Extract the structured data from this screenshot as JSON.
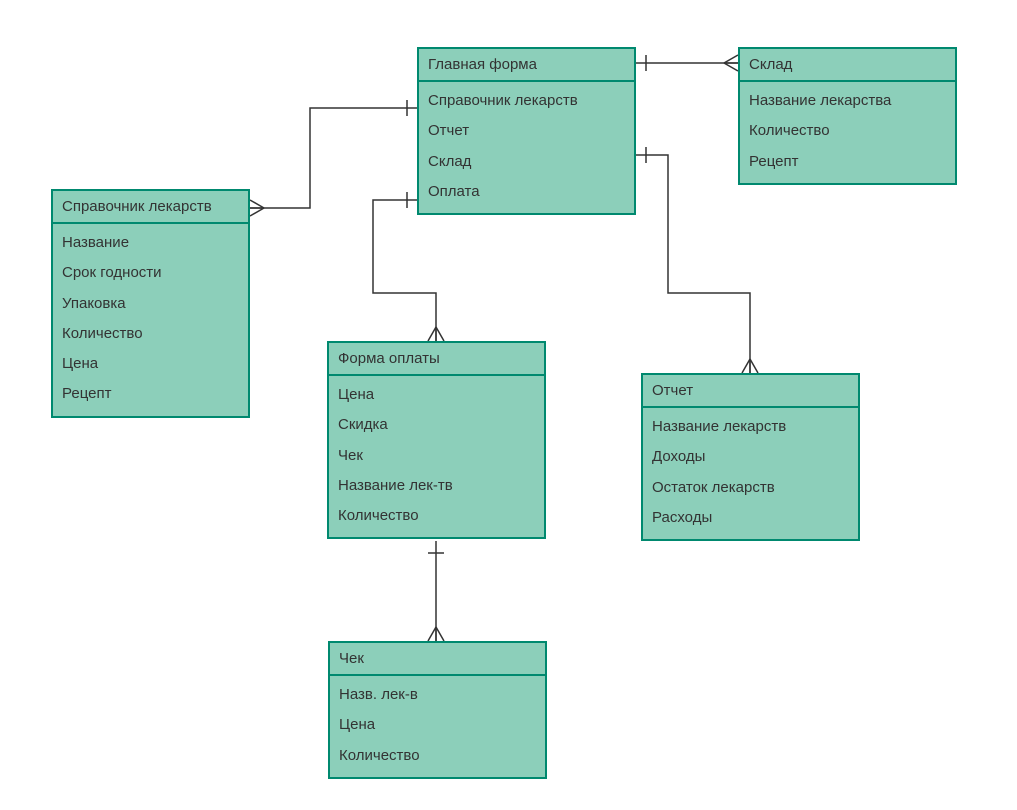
{
  "entities": {
    "mainForm": {
      "title": "Главная форма",
      "attrs": [
        "Справочник лекарств",
        "Отчет",
        "Склад",
        "Оплата"
      ]
    },
    "warehouse": {
      "title": "Склад",
      "attrs": [
        "Название лекарства",
        "Количество",
        "Рецепт"
      ]
    },
    "medsRef": {
      "title": "Справочник лекарств",
      "attrs": [
        "Название",
        "Срок годности",
        "Упаковка",
        "Количество",
        "Цена",
        "Рецепт"
      ]
    },
    "paymentForm": {
      "title": "Форма оплаты",
      "attrs": [
        "Цена",
        "Скидка",
        "Чек",
        "Название лек-тв",
        "Количество"
      ]
    },
    "report": {
      "title": "Отчет",
      "attrs": [
        "Название лекарств",
        "Доходы",
        "Остаток лекарств",
        "Расходы"
      ]
    },
    "receipt": {
      "title": "Чек",
      "attrs": [
        "Назв. лек-в",
        "Цена",
        "Количество"
      ]
    }
  },
  "chart_data": {
    "type": "er-diagram",
    "nodes": [
      {
        "id": "mainForm",
        "title": "Главная форма",
        "attributes": [
          "Справочник лекарств",
          "Отчет",
          "Склад",
          "Оплата"
        ]
      },
      {
        "id": "warehouse",
        "title": "Склад",
        "attributes": [
          "Название лекарства",
          "Количество",
          "Рецепт"
        ]
      },
      {
        "id": "medsRef",
        "title": "Справочник лекарств",
        "attributes": [
          "Название",
          "Срок годности",
          "Упаковка",
          "Количество",
          "Цена",
          "Рецепт"
        ]
      },
      {
        "id": "paymentForm",
        "title": "Форма оплаты",
        "attributes": [
          "Цена",
          "Скидка",
          "Чек",
          "Название лек-тв",
          "Количество"
        ]
      },
      {
        "id": "report",
        "title": "Отчет",
        "attributes": [
          "Название лекарств",
          "Доходы",
          "Остаток лекарств",
          "Расходы"
        ]
      },
      {
        "id": "receipt",
        "title": "Чек",
        "attributes": [
          "Назв. лек-в",
          "Цена",
          "Количество"
        ]
      }
    ],
    "edges": [
      {
        "from": "mainForm",
        "to": "warehouse",
        "fromCardinality": "one",
        "toCardinality": "many"
      },
      {
        "from": "mainForm",
        "to": "medsRef",
        "fromCardinality": "one",
        "toCardinality": "many"
      },
      {
        "from": "mainForm",
        "to": "paymentForm",
        "fromCardinality": "one",
        "toCardinality": "many"
      },
      {
        "from": "mainForm",
        "to": "report",
        "fromCardinality": "one",
        "toCardinality": "many"
      },
      {
        "from": "paymentForm",
        "to": "receipt",
        "fromCardinality": "one",
        "toCardinality": "many"
      }
    ]
  }
}
